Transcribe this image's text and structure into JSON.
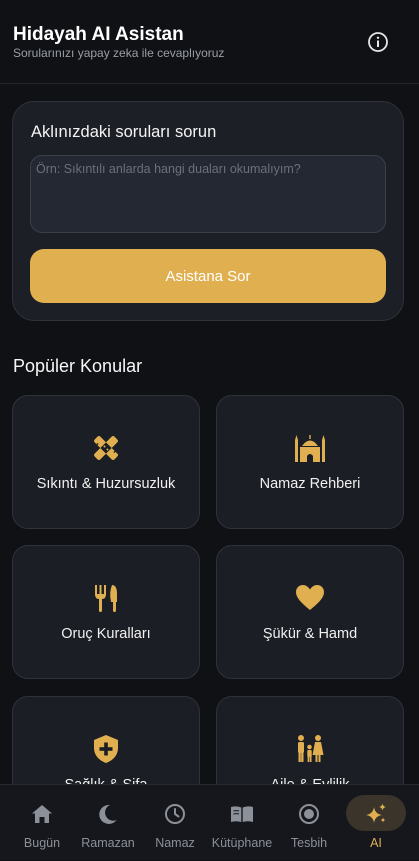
{
  "header": {
    "title": "Hidayah AI Asistan",
    "subtitle": "Sorularınızı yapay zeka ile cevaplıyoruz",
    "info_icon": "info-icon"
  },
  "ask": {
    "title": "Aklınızdaki soruları sorun",
    "placeholder": "Örn: Sıkıntılı anlarda hangi duaları okumalıyım?",
    "value": "",
    "button_label": "Asistana Sor"
  },
  "topics_section": {
    "title": "Popüler Konular",
    "items": [
      {
        "label": "Sıkıntı & Huzursuzluk",
        "icon": "bandage-icon"
      },
      {
        "label": "Namaz Rehberi",
        "icon": "mosque-icon"
      },
      {
        "label": "Oruç Kuralları",
        "icon": "cutlery-icon"
      },
      {
        "label": "Şükür & Hamd",
        "icon": "heart-icon"
      },
      {
        "label": "Sağlık & Şifa",
        "icon": "shield-plus-icon"
      },
      {
        "label": "Aile & Evlilik",
        "icon": "family-icon"
      }
    ]
  },
  "nav": {
    "items": [
      {
        "label": "Bugün",
        "icon": "home-icon"
      },
      {
        "label": "Ramazan",
        "icon": "moon-icon"
      },
      {
        "label": "Namaz",
        "icon": "clock-icon"
      },
      {
        "label": "Kütüphane",
        "icon": "book-icon"
      },
      {
        "label": "Tesbih",
        "icon": "radio-button-icon"
      },
      {
        "label": "AI",
        "icon": "sparkles-icon",
        "active": true
      }
    ]
  },
  "colors": {
    "accent": "#e0b050",
    "background": "#0f1114",
    "card": "#1b1e25",
    "nav_inactive": "#8c9099"
  }
}
